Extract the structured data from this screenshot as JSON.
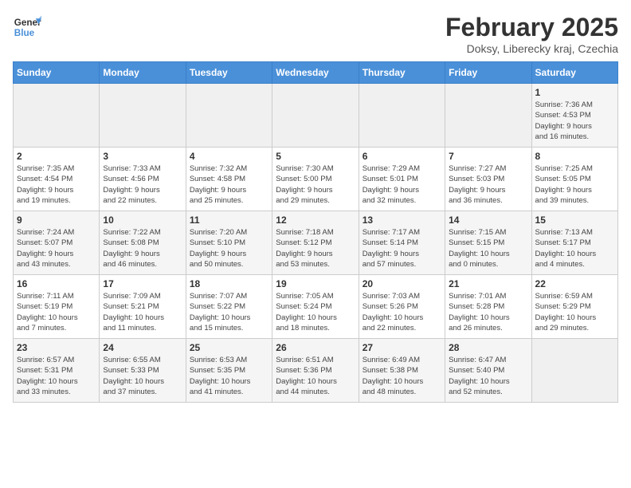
{
  "header": {
    "logo_line1": "General",
    "logo_line2": "Blue",
    "month_title": "February 2025",
    "subtitle": "Doksy, Liberecky kraj, Czechia"
  },
  "days_of_week": [
    "Sunday",
    "Monday",
    "Tuesday",
    "Wednesday",
    "Thursday",
    "Friday",
    "Saturday"
  ],
  "weeks": [
    [
      {
        "day": "",
        "info": ""
      },
      {
        "day": "",
        "info": ""
      },
      {
        "day": "",
        "info": ""
      },
      {
        "day": "",
        "info": ""
      },
      {
        "day": "",
        "info": ""
      },
      {
        "day": "",
        "info": ""
      },
      {
        "day": "1",
        "info": "Sunrise: 7:36 AM\nSunset: 4:53 PM\nDaylight: 9 hours\nand 16 minutes."
      }
    ],
    [
      {
        "day": "2",
        "info": "Sunrise: 7:35 AM\nSunset: 4:54 PM\nDaylight: 9 hours\nand 19 minutes."
      },
      {
        "day": "3",
        "info": "Sunrise: 7:33 AM\nSunset: 4:56 PM\nDaylight: 9 hours\nand 22 minutes."
      },
      {
        "day": "4",
        "info": "Sunrise: 7:32 AM\nSunset: 4:58 PM\nDaylight: 9 hours\nand 25 minutes."
      },
      {
        "day": "5",
        "info": "Sunrise: 7:30 AM\nSunset: 5:00 PM\nDaylight: 9 hours\nand 29 minutes."
      },
      {
        "day": "6",
        "info": "Sunrise: 7:29 AM\nSunset: 5:01 PM\nDaylight: 9 hours\nand 32 minutes."
      },
      {
        "day": "7",
        "info": "Sunrise: 7:27 AM\nSunset: 5:03 PM\nDaylight: 9 hours\nand 36 minutes."
      },
      {
        "day": "8",
        "info": "Sunrise: 7:25 AM\nSunset: 5:05 PM\nDaylight: 9 hours\nand 39 minutes."
      }
    ],
    [
      {
        "day": "9",
        "info": "Sunrise: 7:24 AM\nSunset: 5:07 PM\nDaylight: 9 hours\nand 43 minutes."
      },
      {
        "day": "10",
        "info": "Sunrise: 7:22 AM\nSunset: 5:08 PM\nDaylight: 9 hours\nand 46 minutes."
      },
      {
        "day": "11",
        "info": "Sunrise: 7:20 AM\nSunset: 5:10 PM\nDaylight: 9 hours\nand 50 minutes."
      },
      {
        "day": "12",
        "info": "Sunrise: 7:18 AM\nSunset: 5:12 PM\nDaylight: 9 hours\nand 53 minutes."
      },
      {
        "day": "13",
        "info": "Sunrise: 7:17 AM\nSunset: 5:14 PM\nDaylight: 9 hours\nand 57 minutes."
      },
      {
        "day": "14",
        "info": "Sunrise: 7:15 AM\nSunset: 5:15 PM\nDaylight: 10 hours\nand 0 minutes."
      },
      {
        "day": "15",
        "info": "Sunrise: 7:13 AM\nSunset: 5:17 PM\nDaylight: 10 hours\nand 4 minutes."
      }
    ],
    [
      {
        "day": "16",
        "info": "Sunrise: 7:11 AM\nSunset: 5:19 PM\nDaylight: 10 hours\nand 7 minutes."
      },
      {
        "day": "17",
        "info": "Sunrise: 7:09 AM\nSunset: 5:21 PM\nDaylight: 10 hours\nand 11 minutes."
      },
      {
        "day": "18",
        "info": "Sunrise: 7:07 AM\nSunset: 5:22 PM\nDaylight: 10 hours\nand 15 minutes."
      },
      {
        "day": "19",
        "info": "Sunrise: 7:05 AM\nSunset: 5:24 PM\nDaylight: 10 hours\nand 18 minutes."
      },
      {
        "day": "20",
        "info": "Sunrise: 7:03 AM\nSunset: 5:26 PM\nDaylight: 10 hours\nand 22 minutes."
      },
      {
        "day": "21",
        "info": "Sunrise: 7:01 AM\nSunset: 5:28 PM\nDaylight: 10 hours\nand 26 minutes."
      },
      {
        "day": "22",
        "info": "Sunrise: 6:59 AM\nSunset: 5:29 PM\nDaylight: 10 hours\nand 29 minutes."
      }
    ],
    [
      {
        "day": "23",
        "info": "Sunrise: 6:57 AM\nSunset: 5:31 PM\nDaylight: 10 hours\nand 33 minutes."
      },
      {
        "day": "24",
        "info": "Sunrise: 6:55 AM\nSunset: 5:33 PM\nDaylight: 10 hours\nand 37 minutes."
      },
      {
        "day": "25",
        "info": "Sunrise: 6:53 AM\nSunset: 5:35 PM\nDaylight: 10 hours\nand 41 minutes."
      },
      {
        "day": "26",
        "info": "Sunrise: 6:51 AM\nSunset: 5:36 PM\nDaylight: 10 hours\nand 44 minutes."
      },
      {
        "day": "27",
        "info": "Sunrise: 6:49 AM\nSunset: 5:38 PM\nDaylight: 10 hours\nand 48 minutes."
      },
      {
        "day": "28",
        "info": "Sunrise: 6:47 AM\nSunset: 5:40 PM\nDaylight: 10 hours\nand 52 minutes."
      },
      {
        "day": "",
        "info": ""
      }
    ]
  ]
}
